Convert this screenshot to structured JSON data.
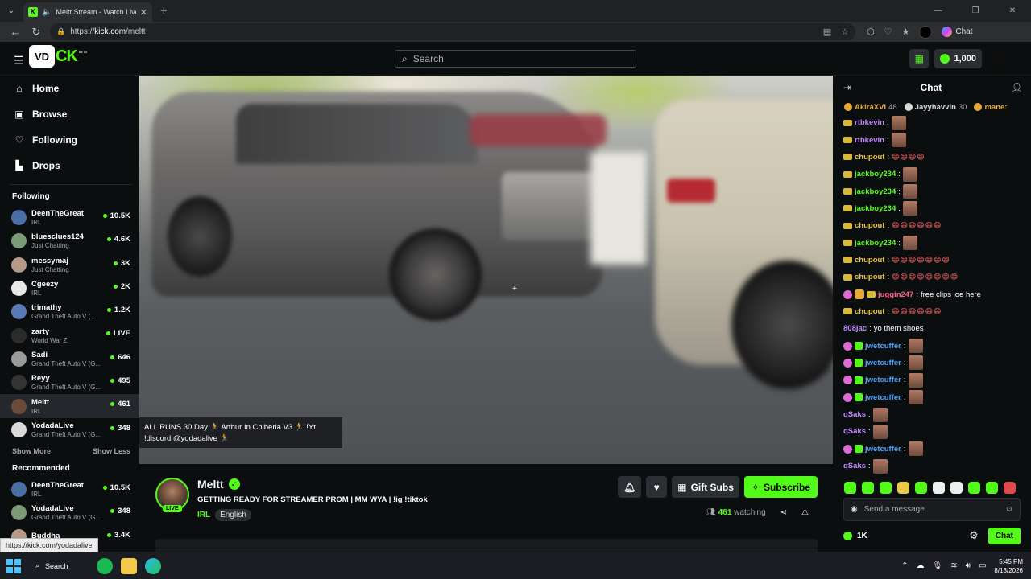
{
  "browser": {
    "tab_title": "Meltt Stream - Watch Live on Kick",
    "tab_favicon": "K",
    "url_scheme": "https://",
    "url_host": "kick.com",
    "url_path": "/meltt",
    "copilot_label": "Chat",
    "status_url": "https://kick.com/yodadalive"
  },
  "header": {
    "logo_badge": "VD",
    "logo_text": "CK",
    "logo_beta": "BETA",
    "search_placeholder": "Search",
    "kicks_balance": "1,000"
  },
  "sidebar": {
    "nav": [
      {
        "label": "Home",
        "icon": "home-icon"
      },
      {
        "label": "Browse",
        "icon": "browse-icon"
      },
      {
        "label": "Following",
        "icon": "heart-icon"
      },
      {
        "label": "Drops",
        "icon": "drops-icon"
      }
    ],
    "following_title": "Following",
    "following": [
      {
        "name": "DeenTheGreat",
        "category": "IRL",
        "viewers": "10.5K"
      },
      {
        "name": "bluesclues124",
        "category": "Just Chatting",
        "viewers": "4.6K"
      },
      {
        "name": "messymaj",
        "category": "Just Chatting",
        "viewers": "3K"
      },
      {
        "name": "Cgeezy",
        "category": "IRL",
        "viewers": "2K"
      },
      {
        "name": "trimathy",
        "category": "Grand Theft Auto V (...",
        "viewers": "1.2K"
      },
      {
        "name": "zarty",
        "category": "World War Z",
        "viewers": "LIVE"
      },
      {
        "name": "Sadi",
        "category": "Grand Theft Auto V (G...",
        "viewers": "646"
      },
      {
        "name": "Reyy",
        "category": "Grand Theft Auto V (G...",
        "viewers": "495"
      },
      {
        "name": "Meltt",
        "category": "IRL",
        "viewers": "461"
      },
      {
        "name": "YodadaLive",
        "category": "Grand Theft Auto V (G...",
        "viewers": "348"
      }
    ],
    "show_more": "Show More",
    "show_less": "Show Less",
    "recommended_title": "Recommended",
    "recommended": [
      {
        "name": "DeenTheGreat",
        "category": "IRL",
        "viewers": "10.5K"
      },
      {
        "name": "YodadaLive",
        "category": "Grand Theft Auto V (G...",
        "viewers": "348"
      },
      {
        "name": "Buddha",
        "category": "",
        "viewers": "3.4K"
      }
    ]
  },
  "video": {
    "overlay_line1": "ALL RUNS 30 Day 🏃 Arthur In Chiberia V3 🏃 !Yt",
    "overlay_line2": "!discord @yodadalive 🏃"
  },
  "stream": {
    "channel": "Meltt",
    "live_label": "LIVE",
    "title": "GETTING READY FOR STREAMER PROM | MM WYA | !ig !tiktok",
    "category": "IRL",
    "language": "English",
    "gift_subs": "Gift Subs",
    "subscribe": "Subscribe",
    "watching_count": "461",
    "watching_label": "watching"
  },
  "chat": {
    "title": "Chat",
    "gifters": [
      {
        "name": "AkiraXVI",
        "count": "48",
        "color": "#e8a93a"
      },
      {
        "name": "Jayyhavvin",
        "count": "30",
        "color": "#d9d9d9"
      },
      {
        "name": "mane:",
        "count": "",
        "color": "#e8a93a"
      }
    ],
    "messages": [
      {
        "user": "rtbkevin",
        "color": "#c28bff",
        "text": "",
        "emote": true,
        "emo": "",
        "badges": [
          "sub"
        ]
      },
      {
        "user": "rtbkevin",
        "color": "#c28bff",
        "text": "",
        "emote": true,
        "emo": "",
        "badges": [
          "sub"
        ]
      },
      {
        "user": "chupout",
        "color": "#e8c94a",
        "text": "",
        "emote": false,
        "emo": "😄😄😄😄",
        "badges": [
          "sub"
        ]
      },
      {
        "user": "jackboy234",
        "color": "#53fc18",
        "text": "",
        "emote": true,
        "emo": "",
        "badges": [
          "sub"
        ]
      },
      {
        "user": "jackboy234",
        "color": "#53fc18",
        "text": "",
        "emote": true,
        "emo": "",
        "badges": [
          "sub"
        ]
      },
      {
        "user": "jackboy234",
        "color": "#53fc18",
        "text": "",
        "emote": true,
        "emo": "",
        "badges": [
          "sub"
        ]
      },
      {
        "user": "chupout",
        "color": "#e8c94a",
        "text": "",
        "emote": false,
        "emo": "😄😄😄😄😄😄",
        "badges": [
          "sub"
        ]
      },
      {
        "user": "jackboy234",
        "color": "#53fc18",
        "text": "",
        "emote": true,
        "emo": "",
        "badges": [
          "sub"
        ]
      },
      {
        "user": "chupout",
        "color": "#e8c94a",
        "text": "",
        "emote": false,
        "emo": "😄😄😄😄😄😄😄",
        "badges": [
          "sub"
        ]
      },
      {
        "user": "chupout",
        "color": "#e8c94a",
        "text": "",
        "emote": false,
        "emo": "😄😄😄😄😄😄😄😄",
        "badges": [
          "sub"
        ]
      },
      {
        "user": "juggin247",
        "color": "#ff5c8a",
        "text": "free clips joe here",
        "emote": false,
        "emo": "",
        "badges": [
          "pink",
          "gold",
          "sub"
        ]
      },
      {
        "user": "chupout",
        "color": "#e8c94a",
        "text": "",
        "emote": false,
        "emo": "😄😄😄😄😄😄",
        "badges": [
          "sub"
        ]
      },
      {
        "user": "808jac",
        "color": "#c28bff",
        "text": "yo them shoes",
        "emote": false,
        "emo": "",
        "badges": []
      },
      {
        "user": "jwetcuffer",
        "color": "#4aa3ff",
        "text": "",
        "emote": true,
        "emo": "",
        "badges": [
          "pink",
          "gift"
        ]
      },
      {
        "user": "jwetcuffer",
        "color": "#4aa3ff",
        "text": "",
        "emote": true,
        "emo": "",
        "badges": [
          "pink",
          "gift"
        ]
      },
      {
        "user": "jwetcuffer",
        "color": "#4aa3ff",
        "text": "",
        "emote": true,
        "emo": "",
        "badges": [
          "pink",
          "gift"
        ]
      },
      {
        "user": "jwetcuffer",
        "color": "#4aa3ff",
        "text": "",
        "emote": true,
        "emo": "",
        "badges": [
          "pink",
          "gift"
        ]
      },
      {
        "user": "qSaks",
        "color": "#c28bff",
        "text": "",
        "emote": true,
        "emo": "",
        "badges": []
      },
      {
        "user": "qSaks",
        "color": "#c28bff",
        "text": "",
        "emote": true,
        "emo": "",
        "badges": []
      },
      {
        "user": "jwetcuffer",
        "color": "#4aa3ff",
        "text": "",
        "emote": true,
        "emo": "",
        "badges": [
          "pink",
          "gift"
        ]
      },
      {
        "user": "qSaks",
        "color": "#c28bff",
        "text": "",
        "emote": true,
        "emo": "",
        "badges": []
      }
    ],
    "input_placeholder": "Send a message",
    "kicks_count": "1K",
    "send_label": "Chat"
  },
  "taskbar": {
    "search_label": "Search",
    "time": "5:45 PM",
    "date": "8/13/2026"
  },
  "colors": {
    "accent": "#53fc18",
    "background": "#0b0e0f",
    "panel": "#191b1f"
  }
}
